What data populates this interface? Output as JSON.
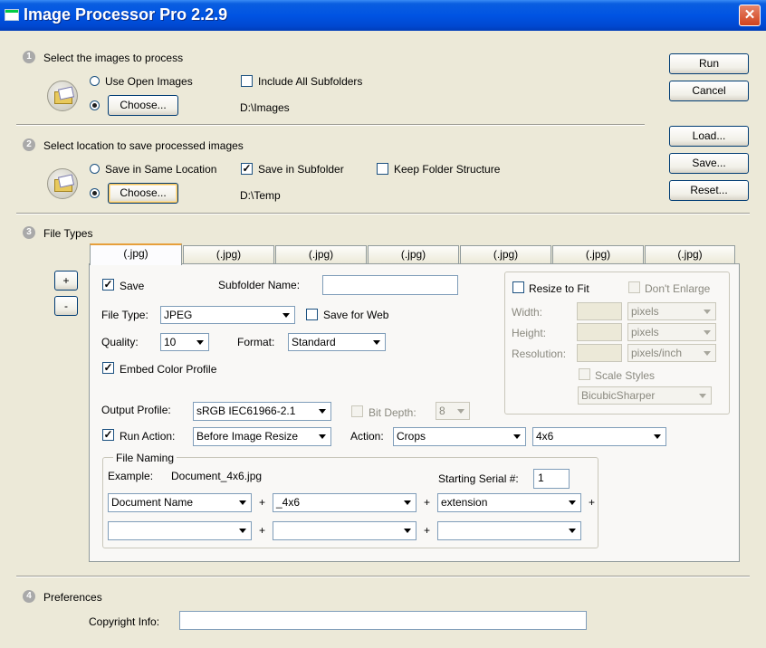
{
  "window": {
    "title": "Image Processor Pro 2.2.9",
    "close_glyph": "✕"
  },
  "section1": {
    "num": "1",
    "title": "Select the images to process",
    "use_open_images": "Use Open Images",
    "include_subfolders": "Include All Subfolders",
    "choose_label": "Choose...",
    "path": "D:\\Images"
  },
  "section2": {
    "num": "2",
    "title": "Select location to save processed images",
    "save_same_location": "Save in Same Location",
    "save_in_subfolder": "Save in Subfolder",
    "keep_folder_structure": "Keep Folder Structure",
    "choose_label": "Choose...",
    "path": "D:\\Temp"
  },
  "section3": {
    "num": "3",
    "title": "File Types",
    "tabs": [
      "(.jpg)",
      "(.jpg)",
      "(.jpg)",
      "(.jpg)",
      "(.jpg)",
      "(.jpg)",
      "(.jpg)"
    ],
    "add_label": "+",
    "remove_label": "-",
    "save_label": "Save",
    "subfolder_name_label": "Subfolder Name:",
    "subfolder_name_value": "",
    "file_type_label": "File Type:",
    "file_type_value": "JPEG",
    "save_for_web": "Save for Web",
    "quality_label": "Quality:",
    "quality_value": "10",
    "format_label": "Format:",
    "format_value": "Standard",
    "embed_profile": "Embed Color Profile",
    "output_profile_label": "Output Profile:",
    "output_profile_value": "sRGB IEC61966-2.1",
    "bit_depth_label": "Bit Depth:",
    "bit_depth_value": "8",
    "run_action_label": "Run Action:",
    "run_action_value": "Before Image Resize",
    "action_label": "Action:",
    "action_set_value": "Crops",
    "action_value": "4x6",
    "resize": {
      "resize_to_fit": "Resize to Fit",
      "dont_enlarge": "Don't Enlarge",
      "width_label": "Width:",
      "height_label": "Height:",
      "resolution_label": "Resolution:",
      "width_unit": "pixels",
      "height_unit": "pixels",
      "resolution_unit": "pixels/inch",
      "scale_styles": "Scale Styles",
      "resample": "BicubicSharper"
    },
    "naming": {
      "group_title": "File Naming",
      "example_label": "Example:",
      "example_value": "Document_4x6.jpg",
      "serial_label": "Starting Serial #:",
      "serial_value": "1",
      "field1": "Document Name",
      "field2": "_4x6",
      "field3": "extension",
      "plus": "+"
    }
  },
  "section4": {
    "num": "4",
    "title": "Preferences",
    "copyright_label": "Copyright Info:",
    "copyright_value": ""
  },
  "buttons": {
    "run": "Run",
    "cancel": "Cancel",
    "load": "Load...",
    "save": "Save...",
    "reset": "Reset..."
  }
}
